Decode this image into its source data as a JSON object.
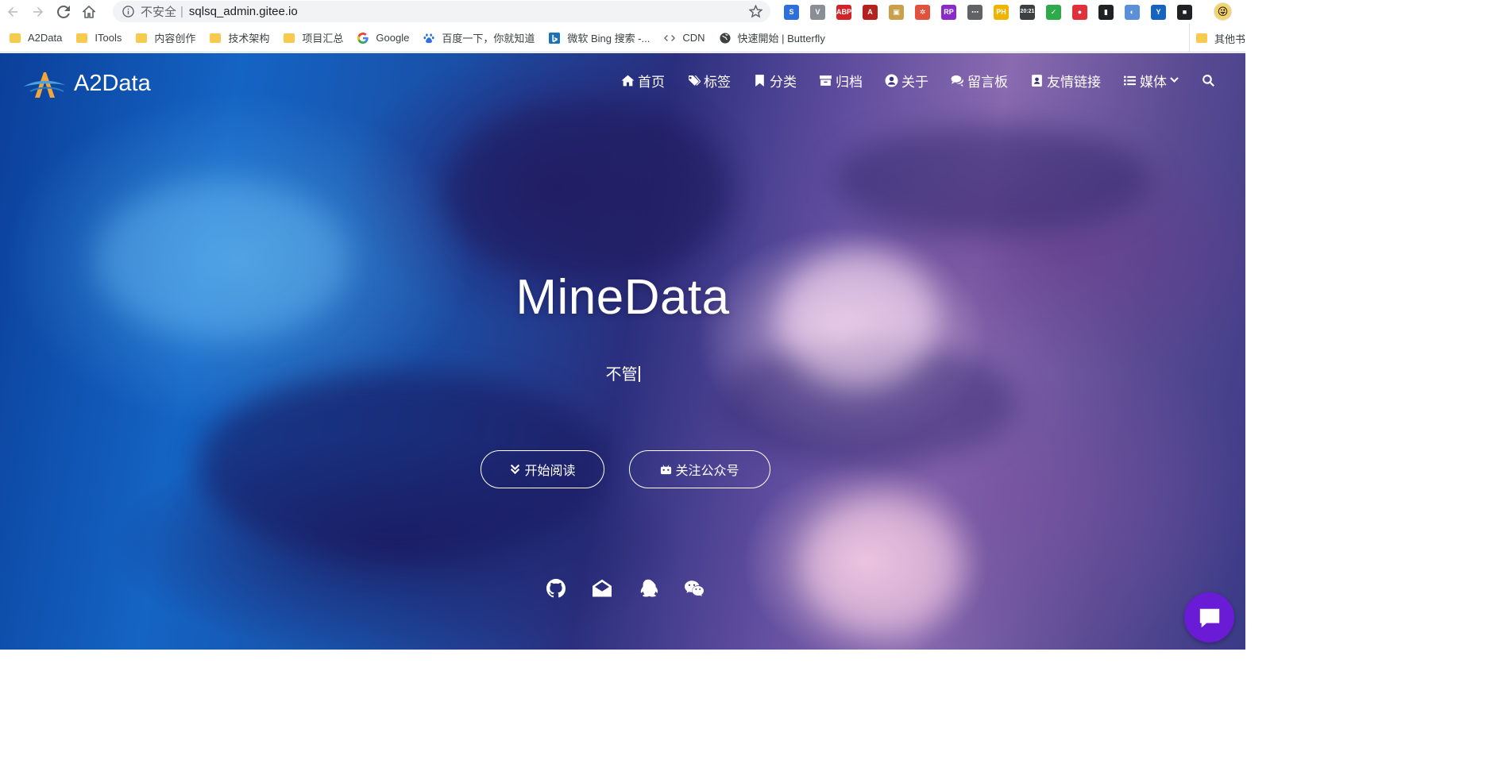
{
  "browser": {
    "address": {
      "security_label": "不安全",
      "url": "sqlsq_admin.gitee.io"
    },
    "extensions": [
      {
        "icon": "s-extension-icon",
        "text": "S",
        "color": "#2f6fdb"
      },
      {
        "icon": "v-extension-icon",
        "text": "V",
        "color": "#8a8f96"
      },
      {
        "icon": "adblock-icon",
        "text": "ABP",
        "color": "#d1232a"
      },
      {
        "icon": "pdf-icon",
        "text": "A",
        "color": "#b3221c"
      },
      {
        "icon": "image-extension-icon",
        "text": "▣",
        "color": "#c9a14a"
      },
      {
        "icon": "nodes-extension-icon",
        "text": "✲",
        "color": "#e0523c"
      },
      {
        "icon": "rp-extension-icon",
        "text": "RP",
        "color": "#8a2bc9"
      },
      {
        "icon": "dots-extension-icon",
        "text": "⋯",
        "color": "#5f6368"
      },
      {
        "icon": "ph-extension-icon",
        "text": "PH",
        "color": "#f0b400"
      },
      {
        "icon": "clock-extension-icon",
        "text": "20:21",
        "color": "#3c4043"
      },
      {
        "icon": "green-extension-icon",
        "text": "✓",
        "color": "#2eaa4a"
      },
      {
        "icon": "timer-extension-icon",
        "text": "●",
        "color": "#e0303c"
      },
      {
        "icon": "bookmark-extension-icon",
        "text": "▮",
        "color": "#202124"
      },
      {
        "icon": "circle-extension-icon",
        "text": "◐",
        "color": "#5b8fd8"
      },
      {
        "icon": "y-extension-icon",
        "text": "Y",
        "color": "#1565c0"
      },
      {
        "icon": "square-extension-icon",
        "text": "■",
        "color": "#202124"
      }
    ],
    "bookmarks": [
      {
        "label": "A2Data",
        "icon": "folder-icon"
      },
      {
        "label": "ITools",
        "icon": "folder-icon"
      },
      {
        "label": "内容创作",
        "icon": "folder-icon"
      },
      {
        "label": "技术架构",
        "icon": "folder-icon"
      },
      {
        "label": "项目汇总",
        "icon": "folder-icon"
      },
      {
        "label": "Google",
        "icon": "google-icon"
      },
      {
        "label": "百度一下，你就知道",
        "icon": "baidu-icon"
      },
      {
        "label": "微软 Bing 搜索 -...",
        "icon": "bing-icon"
      },
      {
        "label": "CDN",
        "icon": "code-icon"
      },
      {
        "label": "快速開始 | Butterfly",
        "icon": "globe-icon"
      }
    ],
    "other_bookmarks": "其他书"
  },
  "site": {
    "brand": "A2Data",
    "nav": [
      {
        "label": "首页",
        "icon": "home-icon"
      },
      {
        "label": "标签",
        "icon": "tags-icon"
      },
      {
        "label": "分类",
        "icon": "bookmark-icon"
      },
      {
        "label": "归档",
        "icon": "archive-icon"
      },
      {
        "label": "关于",
        "icon": "user-icon"
      },
      {
        "label": "留言板",
        "icon": "comments-icon"
      },
      {
        "label": "友情链接",
        "icon": "address-book-icon"
      },
      {
        "label": "媒体",
        "icon": "list-icon"
      }
    ],
    "title": "MineData",
    "subtitle": "不管",
    "buttons": {
      "read": "开始阅读",
      "follow": "关注公众号"
    },
    "socials": [
      "github-icon",
      "envelope-open-icon",
      "qq-icon",
      "wechat-icon"
    ]
  },
  "colors": {
    "chat_fab": "#6a1bd6",
    "omnibox_bg": "#f1f3f4",
    "folder": "#f7cb4d"
  }
}
